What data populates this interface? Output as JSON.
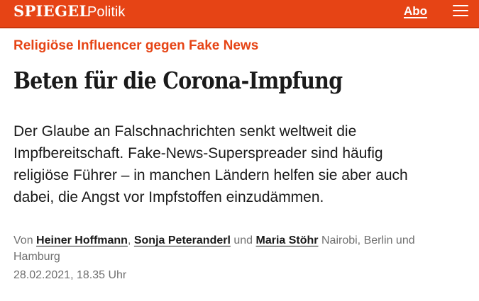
{
  "header": {
    "logo": "SPIEGEL",
    "section": "Politik",
    "abo_label": "Abo",
    "menu_icon": "hamburger-menu-icon",
    "background_color": "#e64415"
  },
  "article": {
    "kicker": "Religiöse Influencer gegen Fake News",
    "headline": "Beten für die Corona-Impfung",
    "teaser_lines": [
      "Der Glaube an Falschnachrichten senkt weltweit die",
      "Impfbereitschaft. Fake-News-Superspreader sind häufig",
      "religiöse Führer – in manchen Ländern helfen sie aber auch",
      "dabei, die Angst vor Impfstoffen einzudämmen."
    ],
    "byline": {
      "prefix": "Von",
      "authors": [
        "Heiner Hoffmann",
        "Sonja Peteranderl",
        "Maria Stöhr"
      ],
      "separator": ",",
      "conjunction": "und",
      "locations_line1": "Nairobi, Berlin und",
      "locations_line2": "Hamburg"
    },
    "date": "28.02.2021, 18.35 Uhr",
    "kicker_color": "#e64415"
  }
}
